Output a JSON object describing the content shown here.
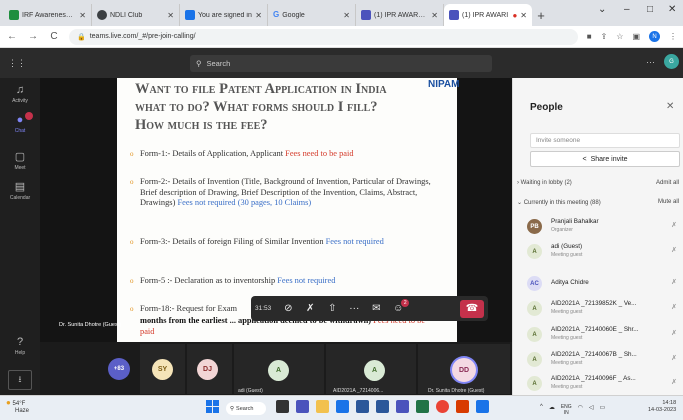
{
  "browser": {
    "tabs": [
      {
        "label": "IRF Awareness - G",
        "color": "#1e8e3e"
      },
      {
        "label": "NDLI Club",
        "color": "#3c4043"
      },
      {
        "label": "You are signed in",
        "color": "#1a73e8"
      },
      {
        "label": "Google",
        "color": "#ffffff"
      },
      {
        "label": "(1) IPR AWARENE",
        "color": "#4b53bc"
      },
      {
        "label": "(1) IPR AWARI",
        "color": "#4b53bc"
      }
    ],
    "url": "teams.live.com/_#/pre-join-calling/"
  },
  "teams": {
    "search_placeholder": "Search",
    "rail": [
      {
        "label": "Activity",
        "icon": "bell-icon"
      },
      {
        "label": "Chat",
        "icon": "chat-icon"
      },
      {
        "label": "Meet",
        "icon": "video-icon"
      },
      {
        "label": "Calendar",
        "icon": "calendar-icon"
      },
      {
        "label": "Help",
        "icon": "help-icon"
      }
    ]
  },
  "slide": {
    "title_l1": "Want to file Patent Application in India",
    "title_l2": "what to do?  What forms should I fill?",
    "title_l3": "How much is the fee?",
    "logo": "NIPAM",
    "b1_text": "Form-1:- Details of Application, Applicant ",
    "b1_fee": "Fees need to be paid",
    "b2_text": "Form-2:- Details of Invention (Title, Background of Invention, Particular of Drawings, Brief description of Drawing, Brief Description of the Invention,  Claims, Abstract, Drawings) ",
    "b2_fee": "Fees not required (30 pages, 10 Claims)",
    "b3_text": "Form-3:- Details of foreign Filing of Similar Invention ",
    "b3_fee": "Fees not required",
    "b4_text": "Form-5 :- Declaration as to inventorship ",
    "b4_fee": "Fees not required",
    "b5_text": "Form-18:- Request for Exam",
    "b5_bold": "months from the earliest ... application deemed to be withdrawn)",
    "b5_fee": "Fees need to be paid"
  },
  "speaker": "Dr. Sunita Dhotre (Guest)",
  "controls": {
    "timer": "31:53",
    "reactions_count": "2"
  },
  "participants_row": [
    {
      "initials": "+83",
      "bg": "#5b5fc7",
      "fg": "#ffffff"
    },
    {
      "initials": "SY",
      "bg": "#f5e4b8",
      "fg": "#7a5a10"
    },
    {
      "initials": "DJ",
      "bg": "#f2d5d5",
      "fg": "#8a2a2a"
    },
    {
      "initials": "A",
      "bg": "#d9ead5",
      "fg": "#3f6b2a",
      "name": "adi (Guest)"
    },
    {
      "initials": "A",
      "bg": "#d9ead5",
      "fg": "#3f6b2a",
      "name": "AID2021A _7214006..."
    },
    {
      "initials": "DD",
      "bg": "#f4d9e3",
      "fg": "#8a2a55",
      "name": "Dr. Sunita Dhotre (Guest)"
    }
  ],
  "people": {
    "title": "People",
    "invite_placeholder": "Invite someone",
    "share_label": "Share invite",
    "lobby": "Waiting in lobby (2)",
    "admit_all": "Admit all",
    "current": "Currently in this meeting (88)",
    "mute_all": "Mute all",
    "list": [
      {
        "initials": "PB",
        "name": "Pranjali Bahalkar",
        "role": "Organizer",
        "photo": true
      },
      {
        "initials": "A",
        "name": "adi (Guest)",
        "role": "Meeting guest"
      },
      {
        "initials": "AC",
        "name": "Aditya Chidre",
        "role": ""
      },
      {
        "initials": "A",
        "name": "AID2021A _72139852K _ Ve...",
        "role": "Meeting guest"
      },
      {
        "initials": "A",
        "name": "AID2021A _72140060E _ Shr...",
        "role": "Meeting guest"
      },
      {
        "initials": "A",
        "name": "AID2021A _72140067B _ Sh...",
        "role": "Meeting guest"
      },
      {
        "initials": "A",
        "name": "AID2021A _72140096F _ As...",
        "role": "Meeting guest"
      }
    ]
  },
  "taskbar": {
    "temp": "54°F",
    "weather": "Haze",
    "search": "Search",
    "lang": "ENG",
    "region": "IN",
    "time": "14:18",
    "date": "14-03-2023"
  }
}
